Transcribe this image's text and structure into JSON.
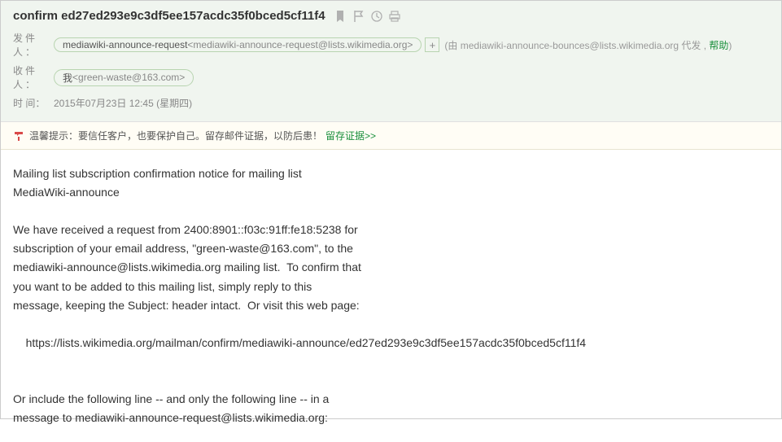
{
  "subject": "confirm ed27ed293e9c3df5ee157acdc35f0bced5cf11f4",
  "labels": {
    "from": "发件人：",
    "to": "收件人：",
    "time": "时   间："
  },
  "from": {
    "name": "mediawiki-announce-request",
    "addr": "<mediawiki-announce-request@lists.wikimedia.org>"
  },
  "sent_by_prefix": "(由 ",
  "sent_by_addr": "mediawiki-announce-bounces@lists.wikimedia.org",
  "sent_by_suffix": " 代发 , ",
  "help": "帮助",
  "sent_by_close": ")",
  "to": {
    "name": "我",
    "addr": "<green-waste@163.com>"
  },
  "time": "2015年07月23日 12:45 (星期四)",
  "tip": {
    "label": "温馨提示：",
    "text": "要信任客户，也要保护自己。留存邮件证据，以防后患！",
    "link": "留存证据>>"
  },
  "body": "Mailing list subscription confirmation notice for mailing list\nMediaWiki-announce\n\nWe have received a request from 2400:8901::f03c:91ff:fe18:5238 for\nsubscription of your email address, \"green-waste@163.com\", to the\nmediawiki-announce@lists.wikimedia.org mailing list.  To confirm that\nyou want to be added to this mailing list, simply reply to this\nmessage, keeping the Subject: header intact.  Or visit this web page:\n\n    https://lists.wikimedia.org/mailman/confirm/mediawiki-announce/ed27ed293e9c3df5ee157acdc35f0bced5cf11f4\n\n\nOr include the following line -- and only the following line -- in a\nmessage to mediawiki-announce-request@lists.wikimedia.org:"
}
